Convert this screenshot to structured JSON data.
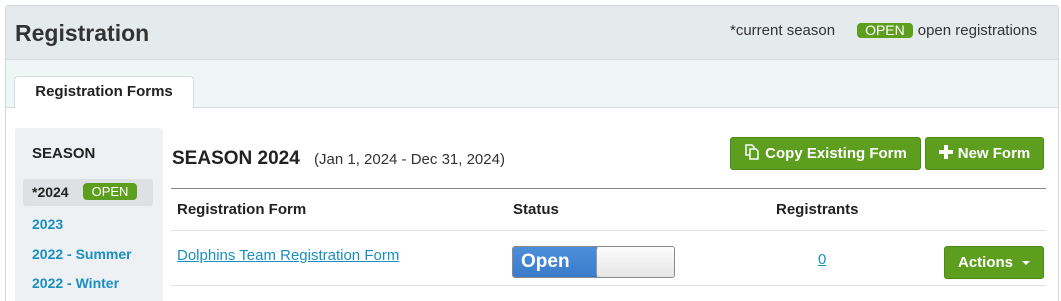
{
  "header": {
    "title": "Registration",
    "legend_current": "*current season",
    "legend_badge": "OPEN",
    "legend_open": "open registrations"
  },
  "tabs": [
    {
      "label": "Registration Forms",
      "active": true
    }
  ],
  "sidebar": {
    "heading": "SEASON",
    "items": [
      {
        "label": "*2024",
        "badge": "OPEN",
        "active": true
      },
      {
        "label": "2023"
      },
      {
        "label": "2022 - Summer"
      },
      {
        "label": "2022 - Winter"
      }
    ]
  },
  "main": {
    "season_title": "SEASON 2024",
    "season_range": "(Jan 1, 2024 - Dec 31, 2024)",
    "copy_button": "Copy Existing Form",
    "new_button": "New Form",
    "columns": [
      "Registration Form",
      "Status",
      "Registrants"
    ],
    "rows": [
      {
        "form": "Dolphins Team Registration Form",
        "status": "Open",
        "registrants": "0",
        "actions": "Actions"
      }
    ]
  },
  "colors": {
    "accent_green": "#5d9e1e",
    "link_blue": "#1a8fbf",
    "toggle_blue": "#4c8fd8"
  },
  "icons": {
    "copy": "copy-icon",
    "new": "plus-icon",
    "actions": "caret-down-icon"
  }
}
